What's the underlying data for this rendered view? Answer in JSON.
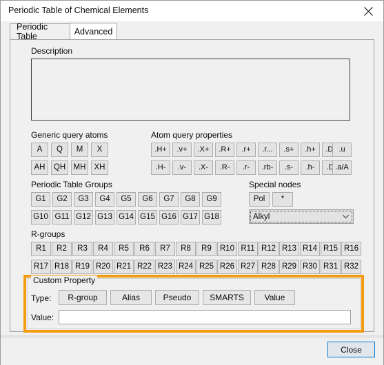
{
  "window": {
    "title": "Periodic Table of Chemical Elements",
    "close_icon": "close-icon"
  },
  "tabs": [
    {
      "label": "Periodic Table",
      "active": false
    },
    {
      "label": "Advanced",
      "active": true
    }
  ],
  "description": {
    "label": "Description",
    "value": ""
  },
  "generic_query_atoms": {
    "label": "Generic query atoms",
    "row1": [
      "A",
      "Q",
      "M",
      "X"
    ],
    "row2": [
      "AH",
      "QH",
      "MH",
      "XH"
    ]
  },
  "atom_query_properties": {
    "label": "Atom query properties",
    "row1": [
      ".H+",
      ".v+",
      ".X+",
      ".R+",
      ".r+",
      ".r...",
      ".s+",
      ".h+",
      ".D+",
      ".u"
    ],
    "row2": [
      ".H-",
      ".v-",
      ".X-",
      ".R-",
      ".r-",
      ".rb-",
      ".s-",
      ".h-",
      ".D-",
      ".a/A"
    ]
  },
  "periodic_table_groups": {
    "label": "Periodic Table Groups",
    "row1": [
      "G1",
      "G2",
      "G3",
      "G4",
      "G5",
      "G6",
      "G7",
      "G8",
      "G9"
    ],
    "row2": [
      "G10",
      "G11",
      "G12",
      "G13",
      "G14",
      "G15",
      "G16",
      "G17",
      "G18"
    ]
  },
  "special_nodes": {
    "label": "Special nodes",
    "buttons": [
      "Pol",
      "*"
    ],
    "dropdown": {
      "value": "Alkyl",
      "arrow_icon": "chevron-down-icon"
    }
  },
  "r_groups": {
    "label": "R-groups",
    "row1": [
      "R1",
      "R2",
      "R3",
      "R4",
      "R5",
      "R6",
      "R7",
      "R8",
      "R9",
      "R10",
      "R11",
      "R12",
      "R13",
      "R14",
      "R15",
      "R16"
    ],
    "row2": [
      "R17",
      "R18",
      "R19",
      "R20",
      "R21",
      "R22",
      "R23",
      "R24",
      "R25",
      "R26",
      "R27",
      "R28",
      "R29",
      "R30",
      "R31",
      "R32"
    ]
  },
  "custom_property": {
    "group_label": "Custom Property",
    "type_label": "Type:",
    "type_buttons": [
      "R-group",
      "Alias",
      "Pseudo",
      "SMARTS",
      "Value"
    ],
    "value_label": "Value:",
    "value_input": "",
    "value_placeholder": "",
    "highlight_color": "#f39c12"
  },
  "footer": {
    "close_label": "Close",
    "accent_color": "#0078d7"
  }
}
